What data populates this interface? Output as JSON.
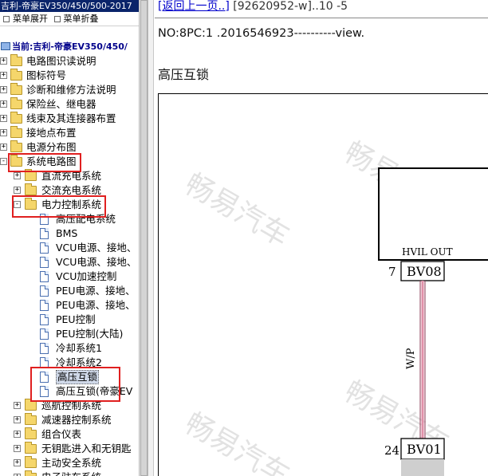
{
  "window": {
    "title": "吉利-帝豪EV350/450/500-2017"
  },
  "toolbar": {
    "expand_label": "菜单展开",
    "collapse_label": "菜单折叠"
  },
  "tree": {
    "current": "当前:吉利-帝豪EV350/450/",
    "items": [
      {
        "label": "电路图识读说明"
      },
      {
        "label": "图标符号"
      },
      {
        "label": "诊断和维修方法说明"
      },
      {
        "label": "保险丝、继电器"
      },
      {
        "label": "线束及其连接器布置"
      },
      {
        "label": "接地点布置"
      },
      {
        "label": "电源分布图"
      },
      {
        "label": "系统电路图"
      },
      {
        "label": "直流充电系统"
      },
      {
        "label": "交流充电系统"
      },
      {
        "label": "电力控制系统"
      },
      {
        "label": "高压配电系统"
      },
      {
        "label": "BMS"
      },
      {
        "label": "VCU电源、接地、"
      },
      {
        "label": "VCU电源、接地、"
      },
      {
        "label": "VCU加速控制"
      },
      {
        "label": "PEU电源、接地、"
      },
      {
        "label": "PEU电源、接地、"
      },
      {
        "label": "PEU控制"
      },
      {
        "label": "PEU控制(大陆)"
      },
      {
        "label": "冷却系统1"
      },
      {
        "label": "冷却系统2"
      },
      {
        "label": "高压互锁"
      },
      {
        "label": "高压互锁(帝豪EV"
      },
      {
        "label": "巡航控制系统"
      },
      {
        "label": "减速器控制系统"
      },
      {
        "label": "组合仪表"
      },
      {
        "label": "无钥匙进入和无钥匙"
      },
      {
        "label": "主动安全系统"
      },
      {
        "label": "电子驻车系统"
      }
    ]
  },
  "content": {
    "back_link": "[返回上一页..]",
    "doc_ref": "[92620952-w]..10 -5",
    "info_line": "NO:8PC:1 .2016546923----------view.",
    "heading": "高压互锁",
    "watermark": "畅易汽车",
    "diagram": {
      "box_label": "HVIL OUT",
      "pin_top": "7",
      "connector_top": "BV08",
      "wire_color": "W/P",
      "pin_bottom": "24",
      "connector_bottom": "BV01"
    }
  },
  "colors": {
    "highlight_box": "#e02020",
    "titlebar": "#0a246a",
    "wire": "#d66a86"
  }
}
